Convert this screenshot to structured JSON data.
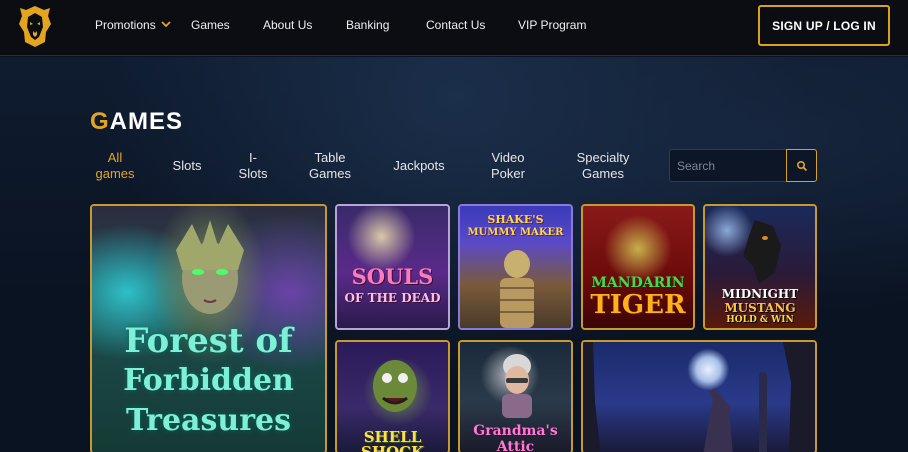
{
  "nav": {
    "items": [
      {
        "label": "Promotions"
      },
      {
        "label": "Games"
      },
      {
        "label": "About Us"
      },
      {
        "label": "Banking"
      },
      {
        "label": "Contact Us"
      },
      {
        "label": "VIP Program"
      }
    ],
    "signup_label": "SIGN UP / LOG IN"
  },
  "games": {
    "title_first": "G",
    "title_rest": "AMES",
    "tabs": [
      {
        "line1": "All",
        "line2": "games",
        "active": true
      },
      {
        "line1": "Slots",
        "line2": ""
      },
      {
        "line1": "I-",
        "line2": "Slots"
      },
      {
        "line1": "Table",
        "line2": "Games"
      },
      {
        "line1": "Jackpots",
        "line2": ""
      },
      {
        "line1": "Video",
        "line2": "Poker"
      },
      {
        "line1": "Specialty",
        "line2": "Games"
      }
    ],
    "search_placeholder": "Search"
  },
  "tiles": [
    {
      "line1": "Forest of",
      "line2": "Forbidden",
      "line3": "Treasures"
    },
    {
      "line1": "SOULS",
      "line2": "OF THE DEAD"
    },
    {
      "line1": "SHAKE'S",
      "line2": "MUMMY MAKER"
    },
    {
      "line1": "MANDARIN",
      "line2": "TIGER"
    },
    {
      "line1": "MIDNIGHT",
      "line2": "MUSTANG",
      "line3": "HOLD & WIN"
    },
    {
      "line1": "SHELL",
      "line2": "SHOCK"
    },
    {
      "line1": "Grandma's",
      "line2": "Attic"
    },
    {}
  ],
  "colors": {
    "accent": "#e3a51f",
    "background": "#0a1322",
    "topbar": "#0b0d12"
  },
  "icons": [
    "lion-logo-icon",
    "chevron-down-icon",
    "search-icon"
  ]
}
